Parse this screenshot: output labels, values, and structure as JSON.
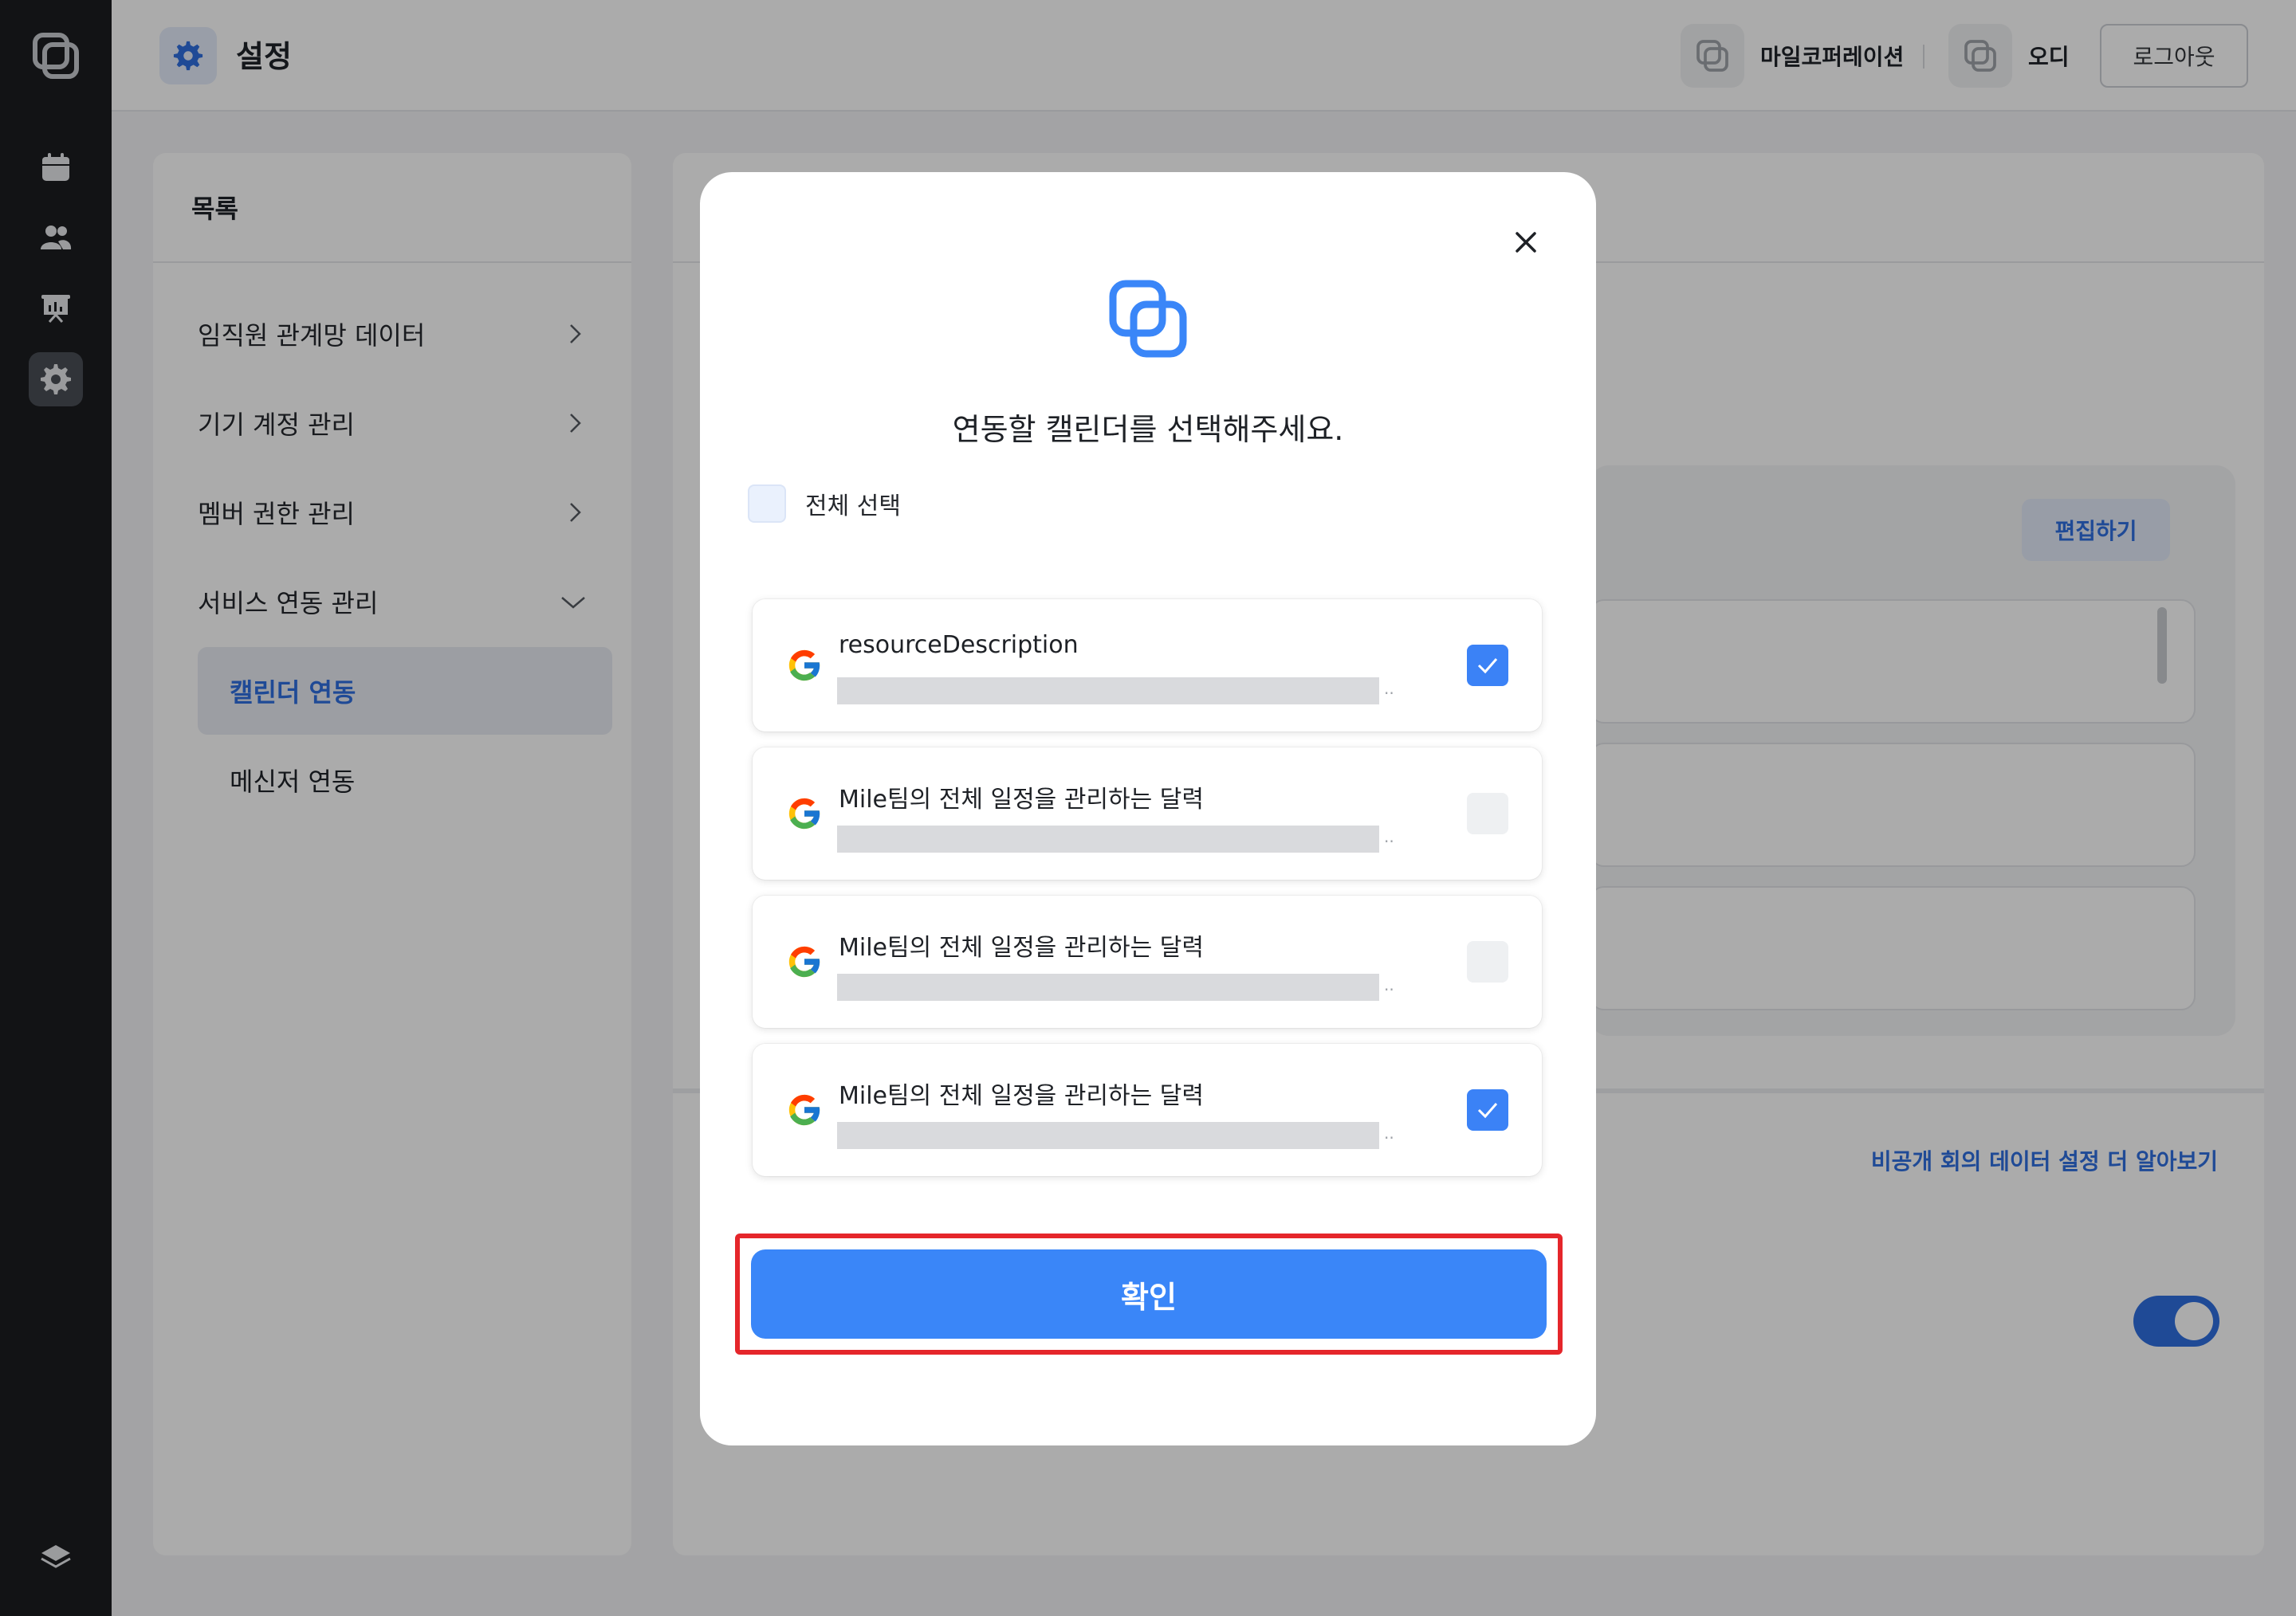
{
  "header": {
    "title": "설정",
    "org_name": "마일코퍼레이션",
    "user_name": "오디",
    "logout_label": "로그아웃"
  },
  "rail": {
    "icons": [
      "app-logo-icon",
      "calendar-icon",
      "people-icon",
      "presentation-icon",
      "settings-icon",
      "layers-icon"
    ],
    "active": "settings-icon"
  },
  "menu": {
    "title": "목록",
    "items": [
      {
        "label": "임직원 관계망 데이터",
        "chevron": "right"
      },
      {
        "label": "기기 계정 관리",
        "chevron": "right"
      },
      {
        "label": "멤버 권한 관리",
        "chevron": "right"
      },
      {
        "label": "서비스 연동 관리",
        "chevron": "down"
      }
    ],
    "subitems": [
      {
        "label": "캘린더 연동",
        "active": true
      },
      {
        "label": "메신저 연동",
        "active": false
      }
    ]
  },
  "content": {
    "edit_label": "편집하기",
    "learn_more_link": "비공개 회의 데이터 설정 더 알아보기",
    "toggle_on": true
  },
  "modal": {
    "title": "연동할 캘린더를 선택해주세요.",
    "select_all_label": "전체 선택",
    "select_all_checked": false,
    "calendars": [
      {
        "name": "resourceDescription",
        "checked": true,
        "icon": "google-icon"
      },
      {
        "name": "Mile팀의 전체 일정을 관리하는 달력",
        "checked": false,
        "icon": "google-icon"
      },
      {
        "name": "Mile팀의 전체 일정을 관리하는 달력",
        "checked": false,
        "icon": "google-icon"
      },
      {
        "name": "Mile팀의 전체 일정을 관리하는 달력",
        "checked": true,
        "icon": "google-icon"
      }
    ],
    "confirm_label": "확인"
  },
  "colors": {
    "accent": "#3a86f8",
    "rail_bg": "#1b1d20",
    "highlight_border": "#e5262b"
  }
}
